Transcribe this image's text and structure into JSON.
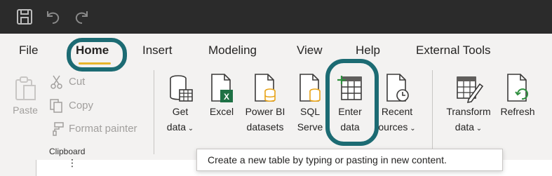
{
  "titlebar": {
    "icons": [
      "save-icon",
      "undo-icon",
      "redo-icon"
    ]
  },
  "tabs": [
    {
      "label": "File"
    },
    {
      "label": "Home",
      "active": true
    },
    {
      "label": "Insert"
    },
    {
      "label": "Modeling"
    },
    {
      "label": "View"
    },
    {
      "label": "Help"
    },
    {
      "label": "External Tools"
    }
  ],
  "clipboard": {
    "paste": "Paste",
    "cut": "Cut",
    "copy": "Copy",
    "format_painter": "Format painter",
    "group_label": "Clipboard"
  },
  "data_group": {
    "get_data": {
      "line1": "Get",
      "line2": "data"
    },
    "excel": {
      "line1": "Excel"
    },
    "powerbi": {
      "line1": "Power BI",
      "line2": "datasets"
    },
    "sql": {
      "line1": "SQL",
      "line2": "Serve"
    },
    "enter_data": {
      "line1": "Enter",
      "line2": "data"
    },
    "recent": {
      "line1": "Recent",
      "line2": "ources"
    }
  },
  "queries": {
    "transform": {
      "line1": "Transform",
      "line2": "data"
    },
    "refresh": {
      "line1": "Refresh"
    }
  },
  "tooltip": "Create a new table by typing or pasting in new content.",
  "colors": {
    "titlebar": "#2b2b2b",
    "ribbon": "#f3f2f1",
    "highlight": "#1c6b73",
    "active_tab_underline": "#e8b52c",
    "excel_green": "#1e7145",
    "powerbi_yellow": "#e8a317",
    "refresh_green": "#2f8f3f"
  }
}
